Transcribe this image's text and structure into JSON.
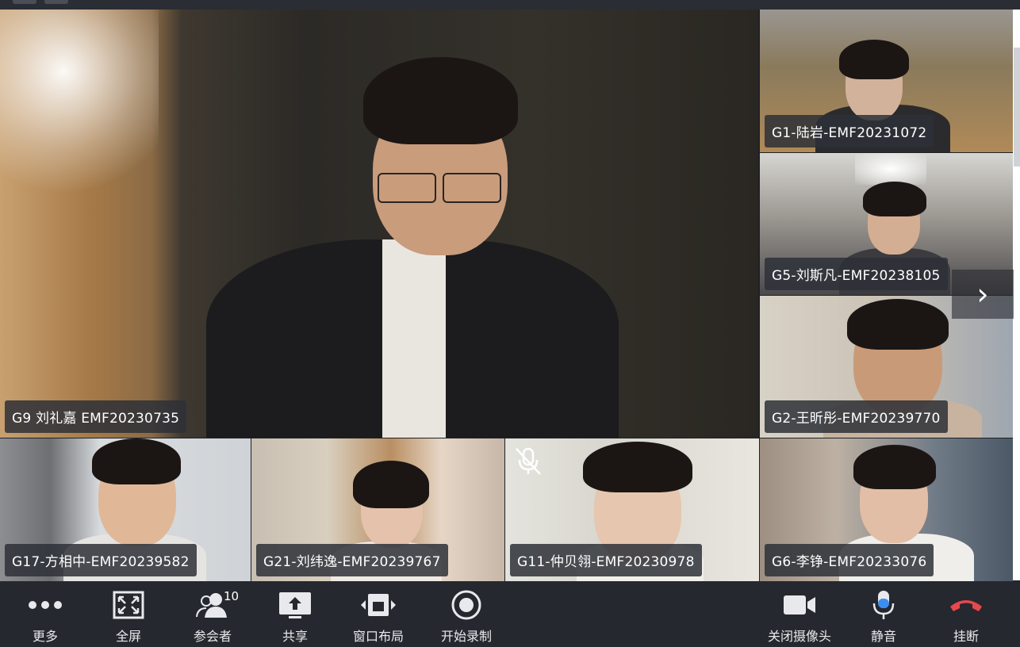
{
  "participants": {
    "main": {
      "name": "G9 刘礼嘉 EMF20230735"
    },
    "side": [
      {
        "name": "G1-陆岩-EMF20231072"
      },
      {
        "name": "G5-刘斯凡-EMF20238105"
      },
      {
        "name": "G2-王昕彤-EMF20239770"
      }
    ],
    "bottom": [
      {
        "name": "G17-方相中-EMF20239582"
      },
      {
        "name": "G21-刘纬逸-EMF20239767"
      },
      {
        "name": "G11-仲贝翎-EMF20230978",
        "muted": true
      },
      {
        "name": "G6-李铮-EMF20233076"
      }
    ]
  },
  "toolbar": {
    "more": {
      "label": "更多",
      "icon": "more-dots-icon"
    },
    "fullscreen": {
      "label": "全屏",
      "icon": "fullscreen-icon"
    },
    "participants": {
      "label": "参会者",
      "count": "10",
      "icon": "participants-icon"
    },
    "share": {
      "label": "共享",
      "icon": "share-upload-icon"
    },
    "layout": {
      "label": "窗口布局",
      "icon": "window-layout-icon"
    },
    "record": {
      "label": "开始录制",
      "icon": "record-icon"
    },
    "camera": {
      "label": "关闭摄像头",
      "icon": "camera-icon"
    },
    "mute": {
      "label": "静音",
      "icon": "microphone-icon",
      "color": "#3b8ef0"
    },
    "hangup": {
      "label": "挂断",
      "icon": "hangup-icon",
      "color": "#e5484d"
    }
  }
}
